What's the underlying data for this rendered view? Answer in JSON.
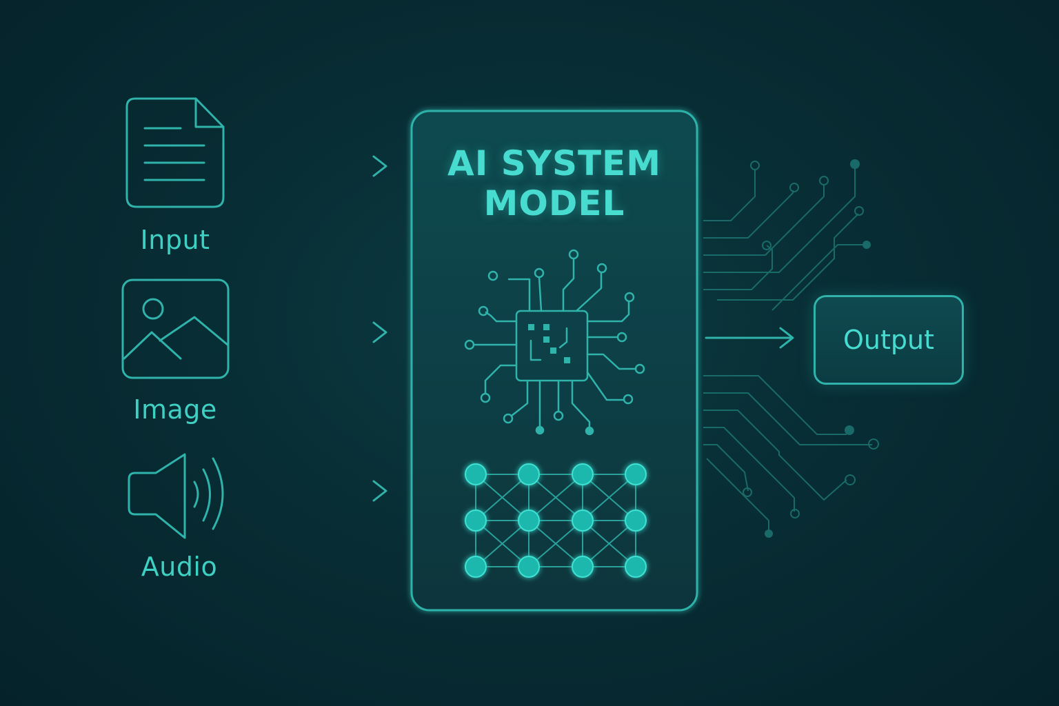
{
  "inputs": [
    {
      "label": "Input",
      "icon": "document-icon"
    },
    {
      "label": "Image",
      "icon": "image-icon"
    },
    {
      "label": "Audio",
      "icon": "speaker-icon"
    }
  ],
  "model": {
    "title_line1": "AI SYSTEM",
    "title_line2": "MODEL",
    "icons": [
      "chip-icon",
      "neural-network-icon"
    ]
  },
  "output": {
    "label": "Output"
  },
  "colors": {
    "background": "#072a31",
    "accent": "#2fb3aa",
    "accent_bright": "#47dccf",
    "node_fill": "#1fb8ad"
  }
}
